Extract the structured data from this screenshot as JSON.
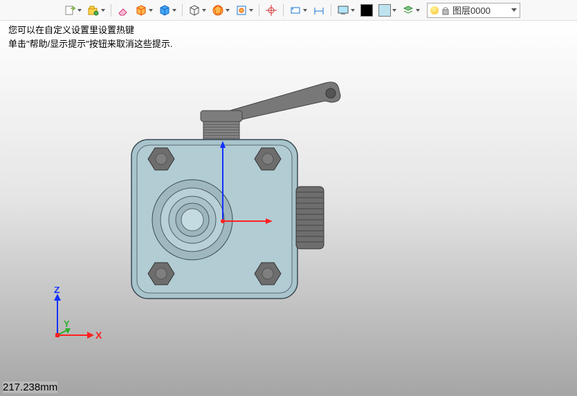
{
  "hint": {
    "line1": "您可以在自定义设置里设置热键",
    "line2": "单击\"帮助/显示提示\"按钮来取消这些提示."
  },
  "layer": {
    "label": "图层0000"
  },
  "axis": {
    "x": "X",
    "y": "Y",
    "z": "Z"
  },
  "status": {
    "measurement": "217.238mm"
  },
  "toolbar": {
    "icons": [
      "export-icon",
      "open-icon",
      "eraser-icon",
      "cube-yellow-icon",
      "cube-blue-icon",
      "cube-wire-icon",
      "dodeca-icon",
      "zoom-fit-icon",
      "target-icon",
      "plane-icon",
      "dimension-icon",
      "monitor-icon",
      "swatch-black",
      "swatch-blue",
      "layers-icon"
    ]
  }
}
